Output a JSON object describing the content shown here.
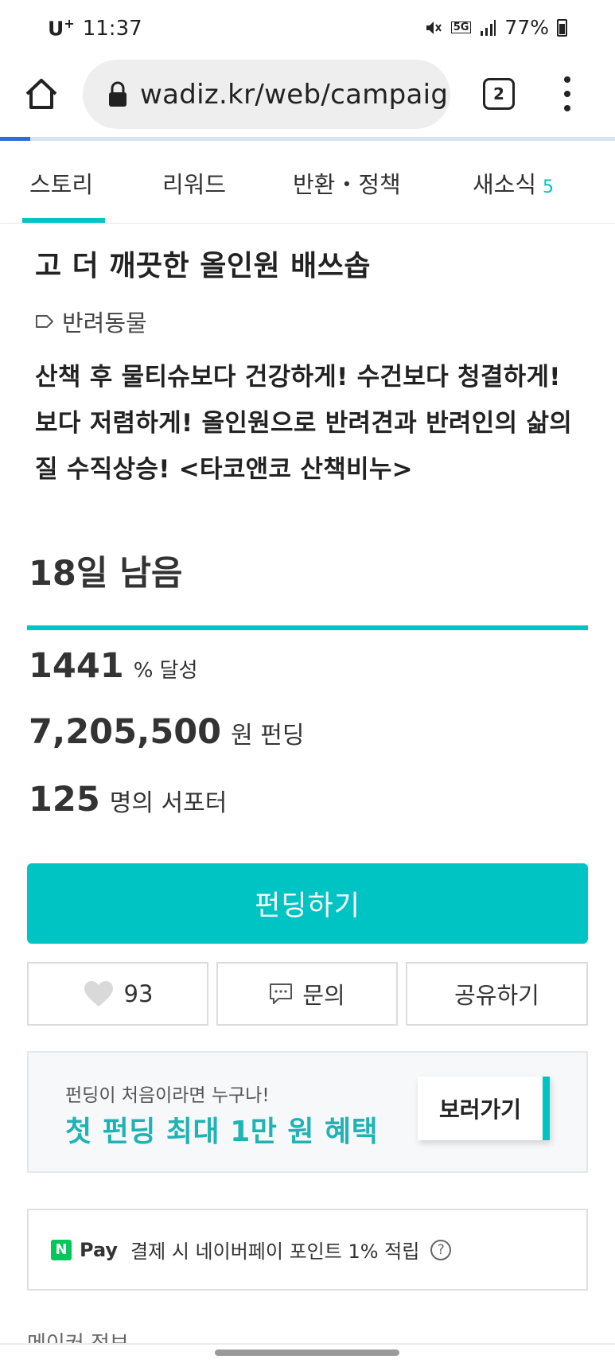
{
  "status_bar": {
    "carrier": "U",
    "carrier_sup": "+",
    "time": "11:37",
    "network": "5G",
    "battery": "77%",
    "icons": [
      "mute-icon",
      "5g-icon",
      "signal-icon",
      "battery-icon"
    ]
  },
  "browser": {
    "url": "wadiz.kr/web/campaign",
    "tab_count": "2"
  },
  "tabs": [
    {
      "label": "스토리",
      "active": true
    },
    {
      "label": "리워드"
    },
    {
      "label": "반환・정책"
    },
    {
      "label": "새소식",
      "badge": "5"
    }
  ],
  "project": {
    "title": "고 더 깨끗한 올인원 배쓰솝",
    "category": "반려동물",
    "description": "산책 후 물티슈보다 건강하게! 수건보다 청결하게! 보다 저렴하게! 올인원으로 반려견과 반려인의 삶의 질 수직상승! <타코앤코 산책비누>"
  },
  "stats": {
    "remaining": "18일 남음",
    "progress_fraction": 1.0,
    "percent_value": "1441",
    "percent_unit": "% 달성",
    "amount_value": "7,205,500",
    "amount_unit": "원 펀딩",
    "supporters_value": "125",
    "supporters_unit": "명의 서포터"
  },
  "actions": {
    "fund_label": "펀딩하기",
    "like_count": "93",
    "inquiry_label": "문의",
    "share_label": "공유하기"
  },
  "promo": {
    "subtitle": "펀딩이 처음이라면 누구나!",
    "headline": "첫 펀딩 최대 1만 원 혜택",
    "button_label": "보러가기"
  },
  "npay": {
    "logo": "N",
    "label": "Pay",
    "text": "결제 시 네이버페이 포인트 1% 적립",
    "help": "?"
  },
  "footer": {
    "maker_info": "메이커 정보"
  },
  "colors": {
    "accent": "#00c4c4",
    "naver_green": "#03c75a",
    "load_bar": "#2a6fd6"
  }
}
